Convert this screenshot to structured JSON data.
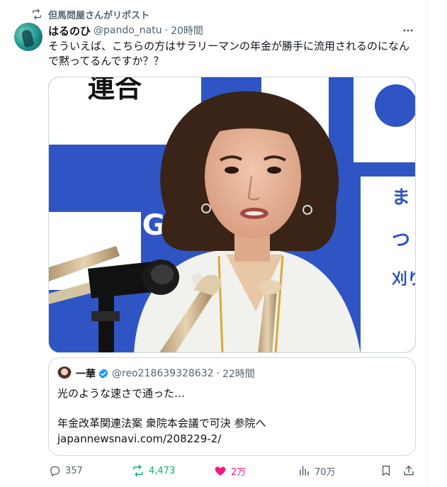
{
  "repost_banner": {
    "text": "但馬問屋さんがリポスト",
    "icon": "repost-icon"
  },
  "tweet": {
    "author_name": "はるのひ",
    "handle": "@pando_natu",
    "separator": "·",
    "time": "20時間",
    "text": "そういえば、こちらの方はサラリーマンの年金が勝手に流用されるのになんで黙ってるんですか？？",
    "more_icon": "more-horizontal-icon"
  },
  "media": {
    "backdrop_text_top": "連合",
    "backdrop_text_left": "RENG",
    "backdrop_text_right": [
      "ま",
      "つ",
      "刈り"
    ],
    "colors": {
      "backdrop_blue": "#2f55c4",
      "jacket": "#f1f1ee",
      "hair": "#3a2418"
    }
  },
  "quote": {
    "author_name": "一華",
    "verified_icon": "verified-badge-icon",
    "handle": "@reo218639328632",
    "separator": "·",
    "time": "22時間",
    "line1": "光のような速さで通った…",
    "line2": "年金改革関連法案 衆院本会議で可決 参院へ",
    "line3": "japannewsnavi.com/208229-2/"
  },
  "actions": {
    "reply_count": "357",
    "repost_count": "4,473",
    "like_count": "2万",
    "views_count": "70万",
    "colors": {
      "repost": "#00ba7c",
      "like": "#f91880",
      "muted": "#536471"
    }
  }
}
